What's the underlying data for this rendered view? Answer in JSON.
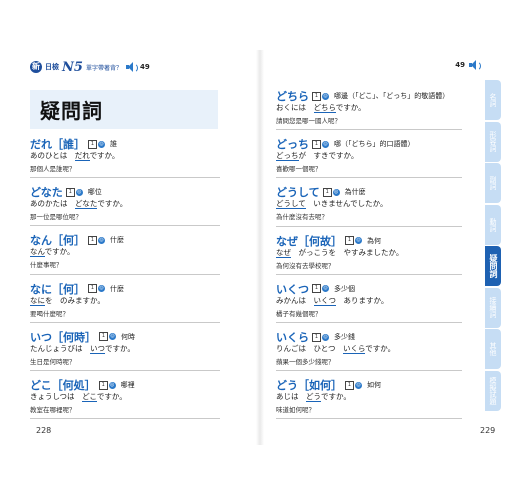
{
  "header": {
    "logo_char": "新",
    "brand": "日檢",
    "level": "N5",
    "subtitle": "單字帶著背？",
    "track": "49",
    "right_track": "49"
  },
  "left_page": {
    "title": "疑問詞",
    "page_number": "228",
    "entries": [
      {
        "word": "だれ［誰］",
        "badge": "1",
        "audio": "◎",
        "meaning": "誰",
        "example_pre": "あのひとは　",
        "example_hl": "だれ",
        "example_post": "ですか。",
        "translation": "那個人是誰呢？"
      },
      {
        "word": "どなた",
        "badge": "1",
        "audio": "◎",
        "meaning": "哪位",
        "example_pre": "あのかたは　",
        "example_hl": "どなた",
        "example_post": "ですか。",
        "translation": "那一位是哪位呢？"
      },
      {
        "word": "なん［何］",
        "badge": "1",
        "audio": "◎",
        "meaning": "什麼",
        "example_pre": "",
        "example_hl": "なん",
        "example_post": "ですか。",
        "translation": "什麼事呢？"
      },
      {
        "word": "なに［何］",
        "badge": "1",
        "audio": "◎",
        "meaning": "什麼",
        "example_pre": "",
        "example_hl": "なに",
        "example_post": "を　のみますか。",
        "translation": "要喝什麼呢？"
      },
      {
        "word": "いつ［何時］",
        "badge": "1",
        "audio": "◎",
        "meaning": "何時",
        "example_pre": "たんじょうびは　",
        "example_hl": "いつ",
        "example_post": "ですか。",
        "translation": "生日是何時呢？"
      },
      {
        "word": "どこ［何処］",
        "badge": "1",
        "audio": "◎",
        "meaning": "哪裡",
        "example_pre": "きょうしつは　",
        "example_hl": "どこ",
        "example_post": "ですか。",
        "translation": "教室在哪裡呢？"
      }
    ]
  },
  "right_page": {
    "page_number": "229",
    "entries": [
      {
        "word": "どちら",
        "badge": "1",
        "audio": "◎",
        "meaning": "哪邊（「どこ」、「どっち」的敬語體）",
        "example_pre": "おくには　",
        "example_hl": "どちら",
        "example_post": "ですか。",
        "translation": "請問您是哪一國人呢？"
      },
      {
        "word": "どっち",
        "badge": "1",
        "audio": "◎",
        "meaning": "哪（「どちら」的口語體）",
        "example_pre": "",
        "example_hl": "どっち",
        "example_post": "が　すきですか。",
        "translation": "喜歡哪一個呢？"
      },
      {
        "word": "どうして",
        "badge": "1",
        "audio": "◎",
        "meaning": "為什麼",
        "example_pre": "",
        "example_hl": "どうして",
        "example_post": "　いきませんでしたか。",
        "translation": "為什麼沒有去呢？"
      },
      {
        "word": "なぜ［何故］",
        "badge": "1",
        "audio": "◎",
        "meaning": "為何",
        "example_pre": "",
        "example_hl": "なぜ",
        "example_post": "　がっこうを　やすみましたか。",
        "translation": "為何沒有去學校呢？"
      },
      {
        "word": "いくつ",
        "badge": "1",
        "audio": "◎",
        "meaning": "多少個",
        "example_pre": "みかんは　",
        "example_hl": "いくつ",
        "example_post": "　ありますか。",
        "translation": "橘子有幾個呢？"
      },
      {
        "word": "いくら",
        "badge": "1",
        "audio": "◎",
        "meaning": "多少錢",
        "example_pre": "りんごは　ひとつ　",
        "example_hl": "いくら",
        "example_post": "ですか。",
        "translation": "蘋果一個多少錢呢？"
      },
      {
        "word": "どう［如何］",
        "badge": "1",
        "audio": "◎",
        "meaning": "如何",
        "example_pre": "あじは　",
        "example_hl": "どう",
        "example_post": "ですか。",
        "translation": "味道如何呢？"
      }
    ]
  },
  "side_tabs": [
    {
      "label": "名詞",
      "active": false
    },
    {
      "label": "形容詞",
      "active": false
    },
    {
      "label": "副詞",
      "active": false
    },
    {
      "label": "動詞",
      "active": false
    },
    {
      "label": "疑問詞",
      "active": true
    },
    {
      "label": "接續詞",
      "active": false
    },
    {
      "label": "其他",
      "active": false
    },
    {
      "label": "模擬試題",
      "active": false
    }
  ]
}
